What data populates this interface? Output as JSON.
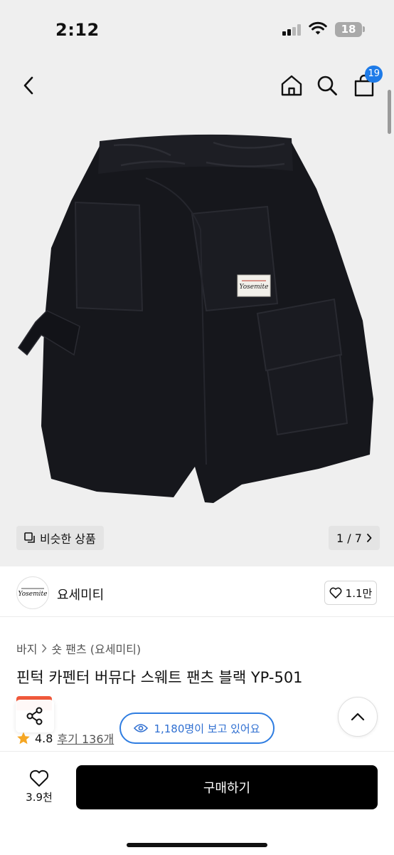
{
  "status_bar": {
    "time": "2:12",
    "battery": "18",
    "icons": [
      "cellular-signal-icon",
      "wifi-icon",
      "battery-icon"
    ]
  },
  "nav": {
    "icons": [
      "back-chevron-icon",
      "home-icon",
      "search-icon",
      "cart-icon"
    ],
    "cart_count": "19"
  },
  "gallery": {
    "similar_label": "비슷한 상품",
    "page_counter": "1 / 7"
  },
  "brand": {
    "name": "요세미티",
    "logo_text": "Yosemite",
    "likes": "1.1만"
  },
  "product": {
    "breadcrumb": [
      "바지",
      "숏 팬츠 (요세미티)"
    ],
    "title": "핀턱 카펜터 버뮤다 스웨트 팬츠 블랙 YP-501",
    "rating": "4.8",
    "reviews": "후기 136개",
    "viewers": "1,180명이 보고 있어요"
  },
  "purchase": {
    "wish_count": "3.9천",
    "buy_label": "구매하기"
  },
  "colors": {
    "accent_blue": "#2f7de1",
    "badge_blue": "#1e7be8",
    "promo_red": "#f25a3c",
    "star": "#f5a623",
    "buy_button": "#000000",
    "image_background": "#efefef"
  }
}
